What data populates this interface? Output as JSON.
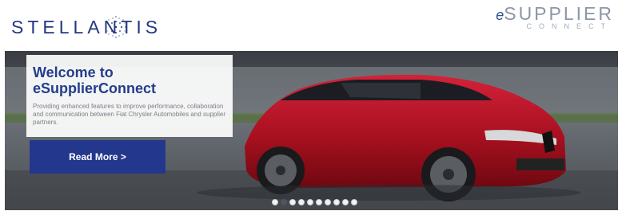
{
  "header": {
    "brand_left": "STELLANTIS",
    "brand_right_prefix": "e",
    "brand_right_main": "SUPPLIER",
    "brand_right_sub": "CONNECT"
  },
  "hero": {
    "title_line1": "Welcome to",
    "title_line2": "eSupplierConnect",
    "description": "Providing enhanced features to improve performance, collaboration and communication between Fiat Chrysler Automobiles and supplier partners.",
    "cta_label": "Read More >",
    "image_icon": "red-suv-photo-icon"
  },
  "carousel": {
    "slide_count": 10,
    "active_index": 1
  },
  "colors": {
    "brand_blue": "#23378c",
    "car_red": "#b01020"
  }
}
